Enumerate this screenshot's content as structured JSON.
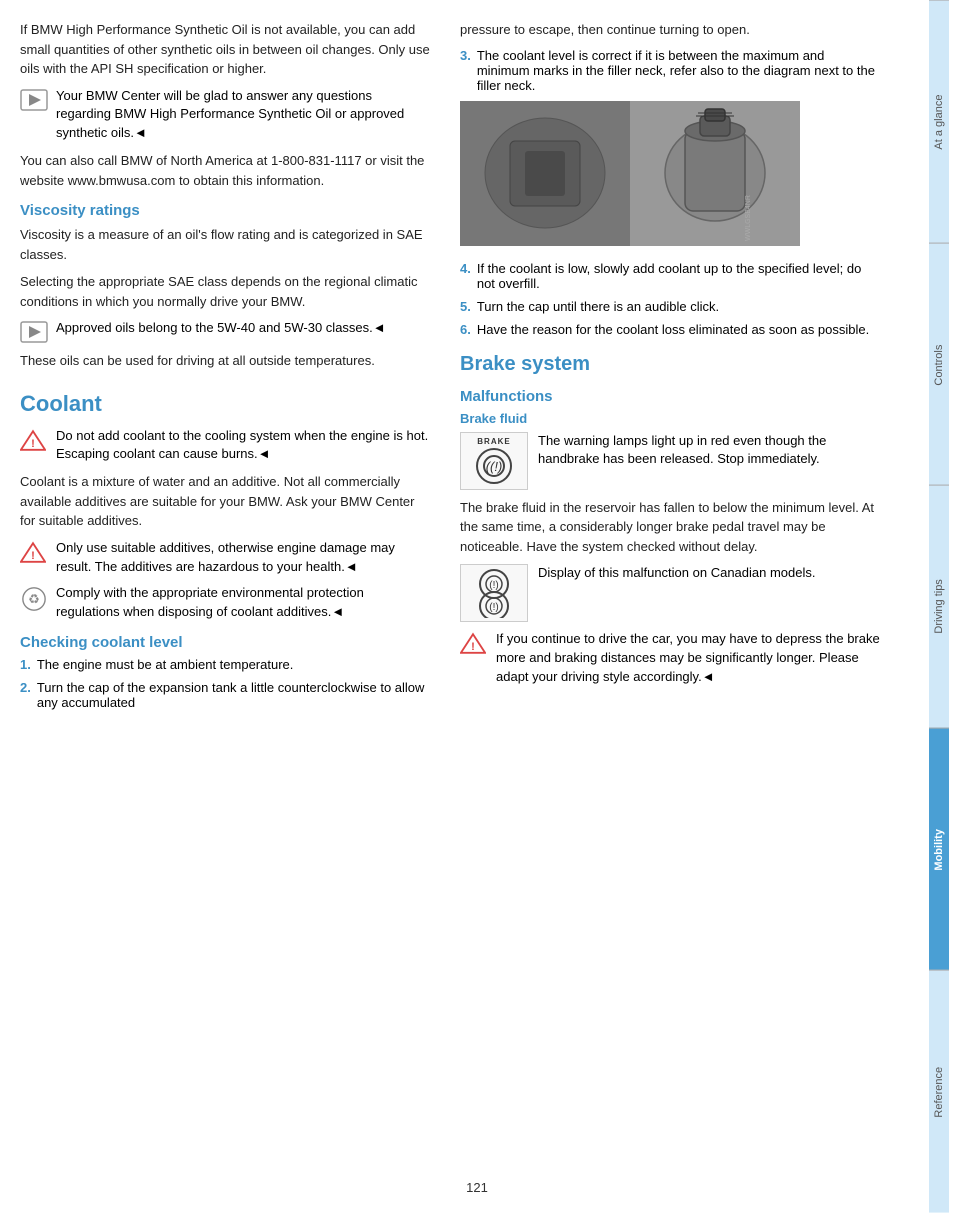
{
  "page": {
    "number": "121"
  },
  "sidebar": {
    "tabs": [
      {
        "id": "at-a-glance",
        "label": "At a glance",
        "active": false
      },
      {
        "id": "controls",
        "label": "Controls",
        "active": false
      },
      {
        "id": "driving-tips",
        "label": "Driving tips",
        "active": false
      },
      {
        "id": "mobility",
        "label": "Mobility",
        "active": true
      },
      {
        "id": "reference",
        "label": "Reference",
        "active": false
      }
    ]
  },
  "left_column": {
    "intro_text": "If BMW High Performance Synthetic Oil is not available, you can add small quantities of other synthetic oils in between oil changes. Only use oils with the API SH specification or higher.",
    "note1": "Your BMW Center will be glad to answer any questions regarding BMW High Performance Synthetic Oil or approved synthetic oils.◄",
    "call_text": "You can also call BMW of North America at 1-800-831-1117 or visit the website www.bmwusa.com to obtain this information.",
    "viscosity_heading": "Viscosity ratings",
    "viscosity_text1": "Viscosity is a measure of an oil's flow rating and is categorized in SAE classes.",
    "viscosity_text2": "Selecting the appropriate SAE class depends on the regional climatic conditions in which you normally drive your BMW.",
    "viscosity_note": "Approved oils belong to the 5W-40 and 5W-30 classes.◄",
    "viscosity_text3": "These oils can be used for driving at all outside temperatures.",
    "coolant_title": "Coolant",
    "coolant_warning": "Do not add coolant to the cooling system when the engine is hot. Escaping coolant can cause burns.◄",
    "coolant_text1": "Coolant is a mixture of water and an additive. Not all commercially available additives are suitable for your BMW. Ask your BMW Center for suitable additives.",
    "coolant_warning2": "Only use suitable additives, otherwise engine damage may result. The additives are hazardous to your health.◄",
    "coolant_env": "Comply with the appropriate environmental protection regulations when disposing of coolant additives.◄",
    "checking_heading": "Checking coolant level",
    "step1": "The engine must be at ambient temperature.",
    "step2": "Turn the cap of the expansion tank a little counterclockwise to allow any accumulated"
  },
  "right_column": {
    "step2_continued": "pressure to escape, then continue turning to open.",
    "step3": "The coolant level is correct if it is between the maximum and minimum marks in the filler neck, refer also to the diagram next to the filler neck.",
    "step4": "If the coolant is low, slowly add coolant up to the specified level; do not overfill.",
    "step5": "Turn the cap until there is an audible click.",
    "step6": "Have the reason for the coolant loss eliminated as soon as possible.",
    "brake_system_title": "Brake system",
    "malfunctions_heading": "Malfunctions",
    "brake_fluid_heading": "Brake fluid",
    "brake_fluid_warning_text": "The warning lamps light up in red even though the handbrake has been released. Stop immediately.",
    "brake_fluid_text": "The brake fluid in the reservoir has fallen to below the minimum level. At the same time, a considerably longer brake pedal travel may be noticeable. Have the system checked without delay.",
    "canadian_text": "Display of this malfunction on Canadian models.",
    "final_warning": "If you continue to drive the car, you may have to depress the brake more and braking distances may be significantly longer. Please adapt your driving style accordingly.◄"
  }
}
